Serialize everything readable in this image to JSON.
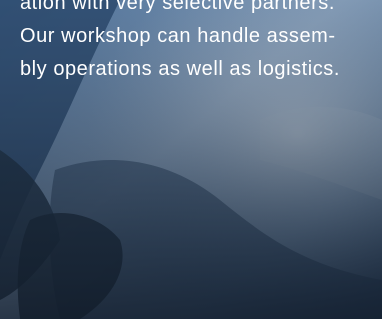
{
  "body_text": {
    "lines": [
      "ation with very selective partners.",
      "Our workshop can handle assem-",
      "bly operations as well as logistics."
    ]
  },
  "colors": {
    "text": "#ffffff",
    "background_top": "#3f6590",
    "background_bottom": "#1c2c40"
  }
}
